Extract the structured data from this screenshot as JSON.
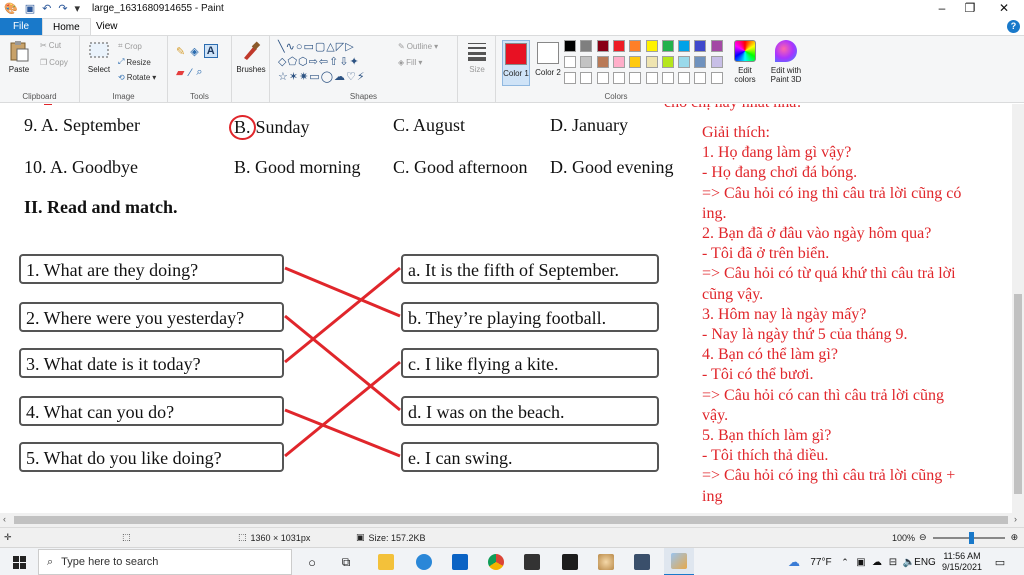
{
  "window": {
    "title": "large_1631680914655 - Paint",
    "minimize": "–",
    "maximize": "❐",
    "close": "✕"
  },
  "ribbon": {
    "tabs": [
      "File",
      "Home",
      "View"
    ],
    "help": "?",
    "clipboard": {
      "paste": "Paste",
      "cut": "Cut",
      "copy": "Copy",
      "label": "Clipboard"
    },
    "image": {
      "select": "Select",
      "crop": "Crop",
      "resize": "Resize",
      "rotate": "Rotate",
      "label": "Image"
    },
    "tools": {
      "label": "Tools"
    },
    "brushes": {
      "label": "Brushes"
    },
    "shapes": {
      "outline": "Outline",
      "fill": "Fill",
      "label": "Shapes"
    },
    "size": {
      "label": "Size"
    },
    "colors": {
      "color1": "Color 1",
      "color2": "Color 2",
      "edit": "Edit colors",
      "paint3d": "Edit with Paint 3D",
      "label": "Colors",
      "color1_value": "#e81123",
      "color2_value": "#ffffff",
      "palette_row1": [
        "#000000",
        "#7f7f7f",
        "#880015",
        "#ed1c24",
        "#ff7f27",
        "#fff200",
        "#22b14c",
        "#00a2e8",
        "#3f48cc",
        "#a349a4"
      ],
      "palette_row2": [
        "#ffffff",
        "#c3c3c3",
        "#b97a57",
        "#ffaec9",
        "#ffc90e",
        "#efe4b0",
        "#b5e61d",
        "#99d9ea",
        "#7092be",
        "#c8bfe7"
      ],
      "palette_row3": [
        "#ffffff",
        "#ffffff",
        "#ffffff",
        "#ffffff",
        "#ffffff",
        "#ffffff",
        "#ffffff",
        "#ffffff",
        "#ffffff",
        "#ffffff"
      ]
    }
  },
  "canvas": {
    "q9": {
      "num": "9. A. September",
      "b": "B.",
      "b_text": "Sunday",
      "c": "C. August",
      "d": "D. January"
    },
    "q10": {
      "num": "10. A. Goodbye",
      "b": "B. Good morning",
      "c": "C. Good afternoon",
      "d": "D. Good evening"
    },
    "section_title": "II. Read and match.",
    "left": [
      "1. What are they doing?",
      "2. Where were you yesterday?",
      "3. What date is it today?",
      "4. What can you do?",
      "5. What do you like doing?"
    ],
    "right": [
      "a. It is the fifth of September.",
      "b. They’re playing football.",
      "c. I like flying a kite.",
      "d. I was on the beach.",
      "e. I can swing."
    ],
    "line_color": "#e0262b",
    "explanation_cut": "cho chị hay nhất nha!",
    "explanation": [
      "Giải thích:",
      "1. Họ đang làm gì vậy?",
      "- Họ đang chơi đá bóng.",
      "=> Câu hỏi có ing thì câu trả lời cũng có",
      "ing.",
      "2. Bạn đã ở đâu vào ngày hôm qua?",
      "- Tôi đã ở trên biển.",
      "=> Câu hỏi có từ quá khứ thì câu trả lời",
      "cũng vậy.",
      "3. Hôm nay là ngày mấy?",
      "- Nay là ngày thứ 5 của tháng 9.",
      "4. Bạn có thể làm gì?",
      "- Tôi có thể bươi.",
      "=> Câu hỏi có can thì câu trả lời cũng",
      "vậy.",
      "5. Bạn thích làm gì?",
      "- Tôi thích thả diều.",
      "=> Câu hỏi có ing thì câu trả lời cũng +",
      "ing"
    ]
  },
  "statusbar": {
    "dimensions": "1360 × 1031px",
    "size": "Size: 157.2KB",
    "zoom": "100%"
  },
  "taskbar": {
    "search_placeholder": "Type here to search",
    "weather": "77°F",
    "lang": "ENG",
    "time": "11:56 AM",
    "date": "9/15/2021"
  }
}
